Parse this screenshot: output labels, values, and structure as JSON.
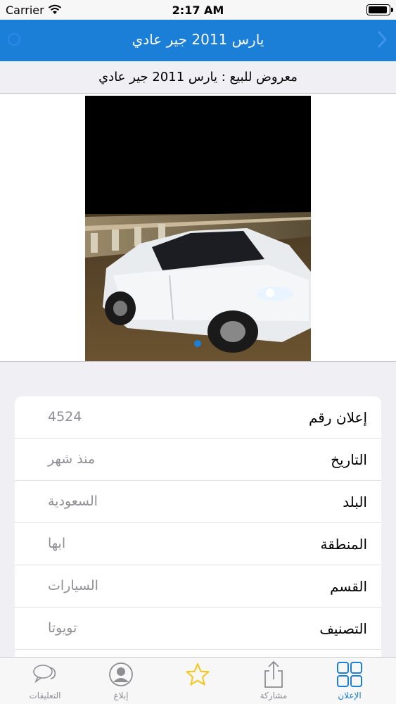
{
  "status_bar": {
    "carrier": "Carrier",
    "time": "2:17 AM"
  },
  "nav": {
    "title": "يارس 2011 جير عادي"
  },
  "subtitle": "معروض للبيع : يارس 2011 جير عادي",
  "gallery": {
    "page_count": 1,
    "current_page": 1
  },
  "details": [
    {
      "label": "إعلان رقم",
      "value": "4524"
    },
    {
      "label": "التاريخ",
      "value": "منذ شهر"
    },
    {
      "label": "البلد",
      "value": "السعودية"
    },
    {
      "label": "المنطقة",
      "value": "ابها"
    },
    {
      "label": "القسم",
      "value": "السيارات"
    },
    {
      "label": "التصنيف",
      "value": "تويوتا"
    }
  ],
  "tabs": [
    {
      "label": "التعليقات",
      "icon": "comments-icon"
    },
    {
      "label": "إبلاغ",
      "icon": "report-user-icon"
    },
    {
      "label": "",
      "icon": "star-icon"
    },
    {
      "label": "مشاركة",
      "icon": "share-icon"
    },
    {
      "label": "الإعلان",
      "icon": "grid-icon",
      "active": true
    }
  ],
  "colors": {
    "accent": "#1b7fd8",
    "star": "#f5c518",
    "inactive": "#8e8e93"
  }
}
